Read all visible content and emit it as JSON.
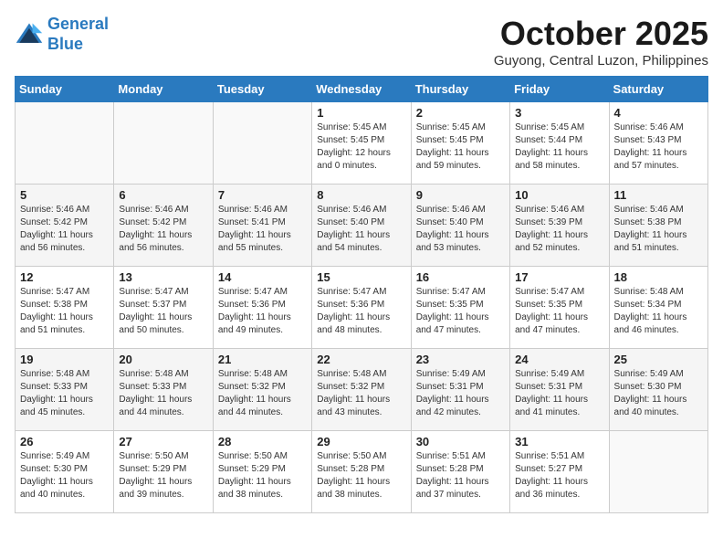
{
  "header": {
    "logo_line1": "General",
    "logo_line2": "Blue",
    "month": "October 2025",
    "location": "Guyong, Central Luzon, Philippines"
  },
  "weekdays": [
    "Sunday",
    "Monday",
    "Tuesday",
    "Wednesday",
    "Thursday",
    "Friday",
    "Saturday"
  ],
  "weeks": [
    [
      {
        "day": "",
        "info": ""
      },
      {
        "day": "",
        "info": ""
      },
      {
        "day": "",
        "info": ""
      },
      {
        "day": "1",
        "info": "Sunrise: 5:45 AM\nSunset: 5:45 PM\nDaylight: 12 hours\nand 0 minutes."
      },
      {
        "day": "2",
        "info": "Sunrise: 5:45 AM\nSunset: 5:45 PM\nDaylight: 11 hours\nand 59 minutes."
      },
      {
        "day": "3",
        "info": "Sunrise: 5:45 AM\nSunset: 5:44 PM\nDaylight: 11 hours\nand 58 minutes."
      },
      {
        "day": "4",
        "info": "Sunrise: 5:46 AM\nSunset: 5:43 PM\nDaylight: 11 hours\nand 57 minutes."
      }
    ],
    [
      {
        "day": "5",
        "info": "Sunrise: 5:46 AM\nSunset: 5:42 PM\nDaylight: 11 hours\nand 56 minutes."
      },
      {
        "day": "6",
        "info": "Sunrise: 5:46 AM\nSunset: 5:42 PM\nDaylight: 11 hours\nand 56 minutes."
      },
      {
        "day": "7",
        "info": "Sunrise: 5:46 AM\nSunset: 5:41 PM\nDaylight: 11 hours\nand 55 minutes."
      },
      {
        "day": "8",
        "info": "Sunrise: 5:46 AM\nSunset: 5:40 PM\nDaylight: 11 hours\nand 54 minutes."
      },
      {
        "day": "9",
        "info": "Sunrise: 5:46 AM\nSunset: 5:40 PM\nDaylight: 11 hours\nand 53 minutes."
      },
      {
        "day": "10",
        "info": "Sunrise: 5:46 AM\nSunset: 5:39 PM\nDaylight: 11 hours\nand 52 minutes."
      },
      {
        "day": "11",
        "info": "Sunrise: 5:46 AM\nSunset: 5:38 PM\nDaylight: 11 hours\nand 51 minutes."
      }
    ],
    [
      {
        "day": "12",
        "info": "Sunrise: 5:47 AM\nSunset: 5:38 PM\nDaylight: 11 hours\nand 51 minutes."
      },
      {
        "day": "13",
        "info": "Sunrise: 5:47 AM\nSunset: 5:37 PM\nDaylight: 11 hours\nand 50 minutes."
      },
      {
        "day": "14",
        "info": "Sunrise: 5:47 AM\nSunset: 5:36 PM\nDaylight: 11 hours\nand 49 minutes."
      },
      {
        "day": "15",
        "info": "Sunrise: 5:47 AM\nSunset: 5:36 PM\nDaylight: 11 hours\nand 48 minutes."
      },
      {
        "day": "16",
        "info": "Sunrise: 5:47 AM\nSunset: 5:35 PM\nDaylight: 11 hours\nand 47 minutes."
      },
      {
        "day": "17",
        "info": "Sunrise: 5:47 AM\nSunset: 5:35 PM\nDaylight: 11 hours\nand 47 minutes."
      },
      {
        "day": "18",
        "info": "Sunrise: 5:48 AM\nSunset: 5:34 PM\nDaylight: 11 hours\nand 46 minutes."
      }
    ],
    [
      {
        "day": "19",
        "info": "Sunrise: 5:48 AM\nSunset: 5:33 PM\nDaylight: 11 hours\nand 45 minutes."
      },
      {
        "day": "20",
        "info": "Sunrise: 5:48 AM\nSunset: 5:33 PM\nDaylight: 11 hours\nand 44 minutes."
      },
      {
        "day": "21",
        "info": "Sunrise: 5:48 AM\nSunset: 5:32 PM\nDaylight: 11 hours\nand 44 minutes."
      },
      {
        "day": "22",
        "info": "Sunrise: 5:48 AM\nSunset: 5:32 PM\nDaylight: 11 hours\nand 43 minutes."
      },
      {
        "day": "23",
        "info": "Sunrise: 5:49 AM\nSunset: 5:31 PM\nDaylight: 11 hours\nand 42 minutes."
      },
      {
        "day": "24",
        "info": "Sunrise: 5:49 AM\nSunset: 5:31 PM\nDaylight: 11 hours\nand 41 minutes."
      },
      {
        "day": "25",
        "info": "Sunrise: 5:49 AM\nSunset: 5:30 PM\nDaylight: 11 hours\nand 40 minutes."
      }
    ],
    [
      {
        "day": "26",
        "info": "Sunrise: 5:49 AM\nSunset: 5:30 PM\nDaylight: 11 hours\nand 40 minutes."
      },
      {
        "day": "27",
        "info": "Sunrise: 5:50 AM\nSunset: 5:29 PM\nDaylight: 11 hours\nand 39 minutes."
      },
      {
        "day": "28",
        "info": "Sunrise: 5:50 AM\nSunset: 5:29 PM\nDaylight: 11 hours\nand 38 minutes."
      },
      {
        "day": "29",
        "info": "Sunrise: 5:50 AM\nSunset: 5:28 PM\nDaylight: 11 hours\nand 38 minutes."
      },
      {
        "day": "30",
        "info": "Sunrise: 5:51 AM\nSunset: 5:28 PM\nDaylight: 11 hours\nand 37 minutes."
      },
      {
        "day": "31",
        "info": "Sunrise: 5:51 AM\nSunset: 5:27 PM\nDaylight: 11 hours\nand 36 minutes."
      },
      {
        "day": "",
        "info": ""
      }
    ]
  ]
}
